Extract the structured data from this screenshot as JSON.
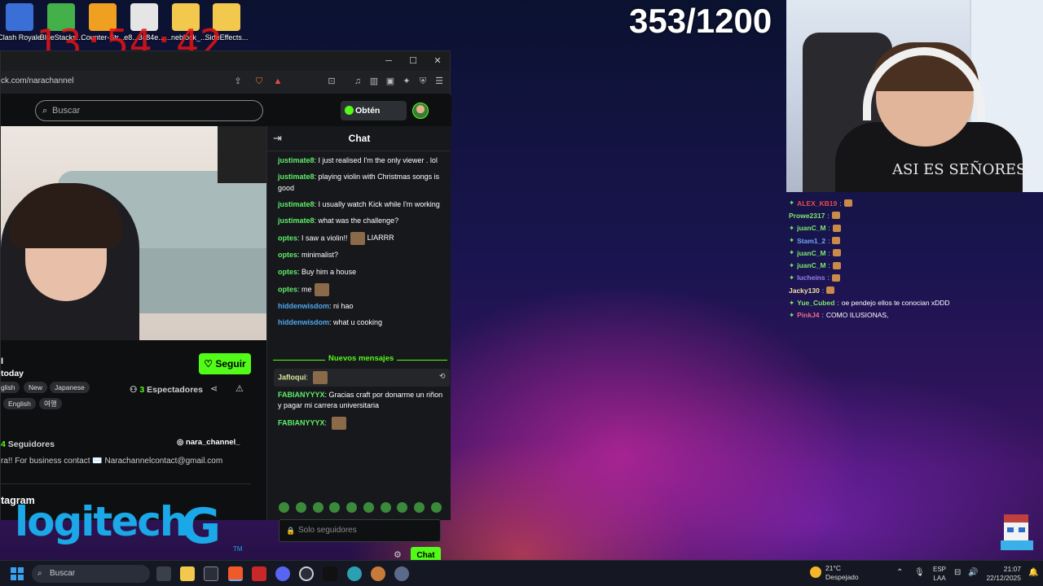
{
  "desktop": {
    "icons": [
      {
        "label": "Clash Royale",
        "color": "#3b6fd8"
      },
      {
        "label": "BlueStacks...",
        "color": "#43b04a"
      },
      {
        "label": "Counter-Str...",
        "color": "#f0a020"
      },
      {
        "label": "e8...3c84e...",
        "color": "#e5e5e5"
      },
      {
        "label": "...neblock_...",
        "color": "#f2c94c"
      },
      {
        "label": "SideEffects...",
        "color": "#f2c94c"
      }
    ],
    "clock_overlay": "13:54:42",
    "counter": "353/1200"
  },
  "webcam": {
    "shirt_text": "ASI ES SEÑORES"
  },
  "overlay_chat": [
    {
      "user": "ALEX_KB19",
      "color": "#e84b4b",
      "badge": true,
      "msg": ""
    },
    {
      "user": "Prowe2317",
      "color": "#7de86a",
      "badge": false,
      "msg": ""
    },
    {
      "user": "juanC_M",
      "color": "#7de86a",
      "badge": true,
      "msg": ""
    },
    {
      "user": "Stam1_2",
      "color": "#6fa8f5",
      "badge": true,
      "msg": ""
    },
    {
      "user": "juanC_M",
      "color": "#7de86a",
      "badge": true,
      "msg": ""
    },
    {
      "user": "juanC_M",
      "color": "#7de86a",
      "badge": true,
      "msg": ""
    },
    {
      "user": "lucheins",
      "color": "#9a7df0",
      "badge": true,
      "msg": ""
    },
    {
      "user": "Jacky130",
      "color": "#f3e0a0",
      "badge": false,
      "msg": ""
    },
    {
      "user": "Yue_Cubed",
      "color": "#7de86a",
      "badge": true,
      "msg": "oe pendejo ellos te conocian xDDD"
    },
    {
      "user": "PinkJ4",
      "color": "#e86a8a",
      "badge": true,
      "msg": "COMO ILUSIONAS,"
    }
  ],
  "browser": {
    "url": "ck.com/narachannel",
    "search_placeholder": "Buscar",
    "kicks_button": "Obtén KICKs",
    "follow_button": "Seguir",
    "channel_name_partial": "I",
    "stream_title_partial": "today",
    "tags": [
      "glish",
      "New",
      "Japanese",
      "English",
      "여행"
    ],
    "viewers_count": "3",
    "viewers_label": "Espectadores",
    "followers_count": "4",
    "followers_label": "Seguidores",
    "instagram_handle": "nara_channel_",
    "bio": "ra!! For business contact ✉️ Narachannelcontact@gmail.com",
    "instagram_section": "tagram"
  },
  "chat": {
    "title": "Chat",
    "messages": [
      {
        "user": "justimate8",
        "user_color": "green",
        "text": "I just realised I'm the only viewer . lol",
        "emote": false
      },
      {
        "user": "justimate8",
        "user_color": "green",
        "text": "playing violin with Christmas songs is good",
        "emote": false
      },
      {
        "user": "justimate8",
        "user_color": "green",
        "text": "I usually watch Kick while I'm working",
        "emote": false
      },
      {
        "user": "justimate8",
        "user_color": "green",
        "text": "what was the challenge?",
        "emote": false
      },
      {
        "user": "optes",
        "user_color": "green",
        "text": "I saw a violin!!",
        "emote": true,
        "suffix": "LIARRR"
      },
      {
        "user": "optes",
        "user_color": "green",
        "text": "minimalist?",
        "emote": false
      },
      {
        "user": "optes",
        "user_color": "green",
        "text": "Buy him a house",
        "emote": false
      },
      {
        "user": "optes",
        "user_color": "green",
        "text": "me",
        "emote": true
      },
      {
        "user": "hiddenwisdom",
        "user_color": "blue",
        "text": "ni hao",
        "emote": false
      },
      {
        "user": "hiddenwisdom",
        "user_color": "blue",
        "text": "what u cooking",
        "emote": false
      }
    ],
    "new_messages_label": "Nuevos mensajes",
    "new_messages": [
      {
        "user": "Jafloqui",
        "user_color": "pale",
        "text": "",
        "emote": true
      },
      {
        "user": "FABIANYYYX",
        "user_color": "green",
        "text": "Gracias craft por donarme un riñon y pagar mi carrera universitaria",
        "emote": false
      },
      {
        "user": "FABIANYYYX",
        "user_color": "green",
        "text": "",
        "emote": true
      }
    ],
    "input_placeholder": "Solo seguidores",
    "send_button": "Chat"
  },
  "logitech": {
    "word": "logitech",
    "g": "G",
    "tm": "TM"
  },
  "taskbar": {
    "search_placeholder": "Buscar",
    "temperature": "21°C",
    "weather": "Despejado",
    "lang_top": "ESP",
    "lang_bottom": "LAA",
    "time": "21:07",
    "date": "22/12/2025"
  }
}
